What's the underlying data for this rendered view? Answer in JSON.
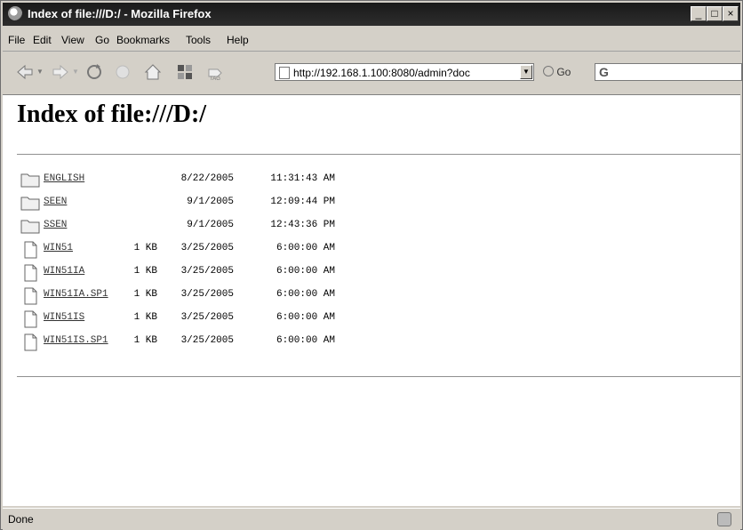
{
  "window": {
    "title": "Index of file:///D:/ - Mozilla Firefox",
    "minimize": "_",
    "maximize": "□",
    "close": "×"
  },
  "menu": [
    "File",
    "Edit",
    "View",
    "Go",
    "Bookmarks",
    "Tools",
    "Help"
  ],
  "toolbar": {
    "icons": [
      "back-icon",
      "forward-icon",
      "reload-icon",
      "stop-icon",
      "home-icon",
      "bookmark-icon",
      "tag-icon"
    ],
    "url": "http://192.168.1.100:8080/admin?doc",
    "go_label": "Go",
    "search_glyph": "G"
  },
  "page": {
    "heading": "Index of file:///D:/",
    "entries": [
      {
        "type": "folder",
        "name": "ENGLISH",
        "size": "",
        "date": "8/22/2005",
        "time": "11:31:43 AM"
      },
      {
        "type": "folder",
        "name": "SEEN",
        "size": "",
        "date": "9/1/2005",
        "time": "12:09:44 PM"
      },
      {
        "type": "folder",
        "name": "SSEN",
        "size": "",
        "date": "9/1/2005",
        "time": "12:43:36 PM"
      },
      {
        "type": "file",
        "name": "WIN51",
        "size": "1 KB",
        "date": "3/25/2005",
        "time": "6:00:00 AM"
      },
      {
        "type": "file",
        "name": "WIN51IA",
        "size": "1 KB",
        "date": "3/25/2005",
        "time": "6:00:00 AM"
      },
      {
        "type": "file",
        "name": "WIN51IA.SP1",
        "size": "1 KB",
        "date": "3/25/2005",
        "time": "6:00:00 AM"
      },
      {
        "type": "file",
        "name": "WIN51IS",
        "size": "1 KB",
        "date": "3/25/2005",
        "time": "6:00:00 AM"
      },
      {
        "type": "file",
        "name": "WIN51IS.SP1",
        "size": "1 KB",
        "date": "3/25/2005",
        "time": "6:00:00 AM"
      }
    ]
  },
  "status": {
    "text": "Done"
  }
}
